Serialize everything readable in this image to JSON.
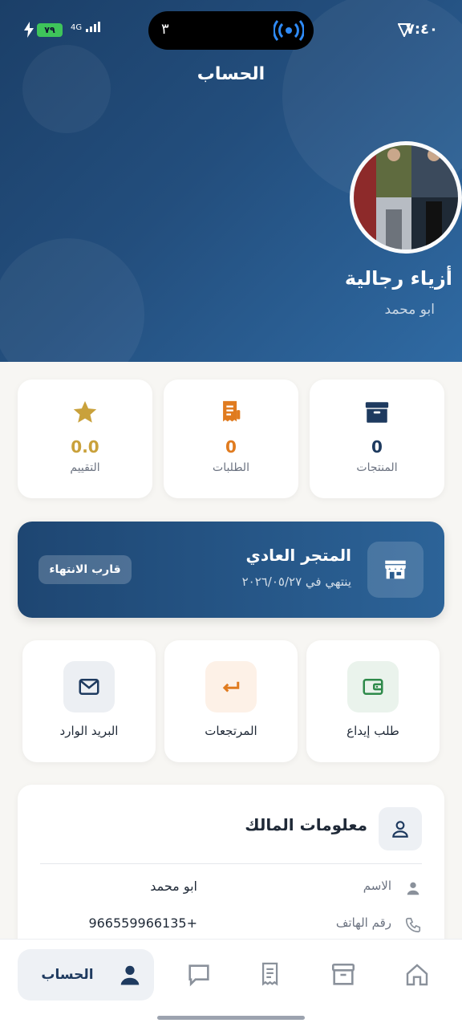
{
  "status_bar": {
    "time": "٧:٤٠",
    "island_number": "٣",
    "network": "4G",
    "battery": "٧٩"
  },
  "header": {
    "title": "الحساب",
    "store_name": "أزياء رجالية",
    "owner_name": "ابو محمد"
  },
  "stats": [
    {
      "label": "المنتجات",
      "value": "0",
      "icon": "archive-box-icon",
      "color": "#1e3a5f"
    },
    {
      "label": "الطلبات",
      "value": "0",
      "icon": "receipt-icon",
      "color": "#e07b1f"
    },
    {
      "label": "التقييم",
      "value": "0.0",
      "icon": "star-icon",
      "color": "#c9a13b"
    }
  ],
  "plan": {
    "title": "المتجر العادي",
    "expiry": "ينتهي في ٢٠٢٦/٠٥/٢٧",
    "badge": "قارب الانتهاء"
  },
  "actions": [
    {
      "label": "طلب إيداع",
      "icon": "wallet-icon",
      "color": "#2e8a4a"
    },
    {
      "label": "المرتجعات",
      "icon": "return-arrow-icon",
      "color": "#e07b1f"
    },
    {
      "label": "البريد الوارد",
      "icon": "mail-icon",
      "color": "#1e3a5f"
    }
  ],
  "owner_info": {
    "title": "معلومات المالك",
    "rows": [
      {
        "label": "الاسم",
        "value": "ابو محمد",
        "icon": "person-icon"
      },
      {
        "label": "رقم الهاتف",
        "value": "966559966135+",
        "icon": "phone-icon"
      }
    ]
  },
  "bottom_nav": {
    "active_label": "الحساب",
    "items": [
      "home-icon",
      "archive-icon",
      "receipt-icon",
      "chat-icon",
      "person-icon"
    ]
  }
}
